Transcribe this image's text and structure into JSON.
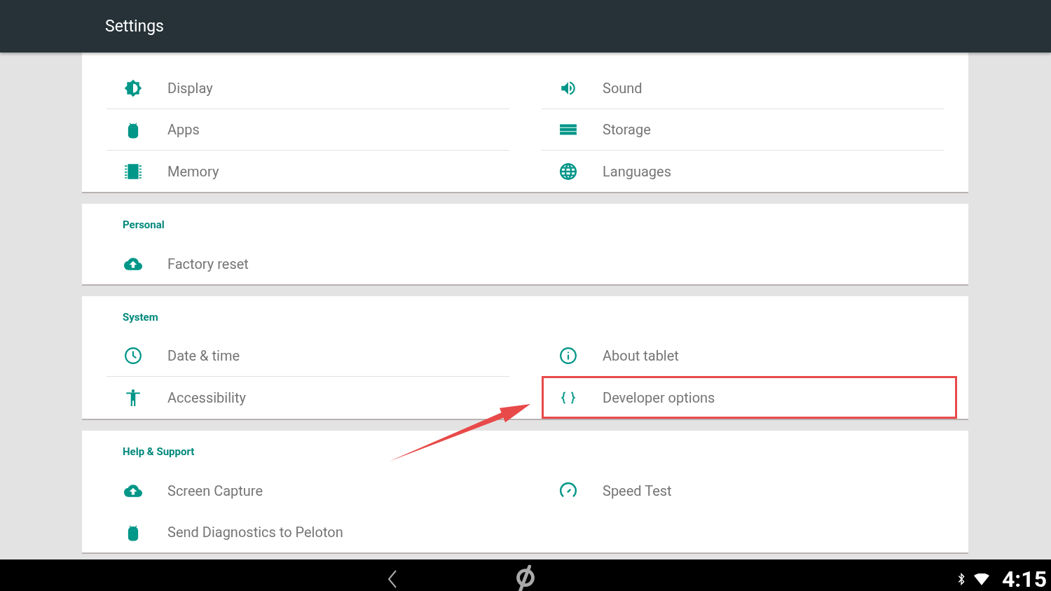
{
  "app_bar": {
    "title": "Settings"
  },
  "sections": [
    {
      "dividers": true,
      "items": [
        {
          "label": "Display",
          "kind": "brightness",
          "highlighted": false
        },
        {
          "label": "Sound",
          "kind": "volume",
          "highlighted": false
        },
        {
          "label": "Apps",
          "kind": "android",
          "highlighted": false
        },
        {
          "label": "Storage",
          "kind": "storage",
          "highlighted": false
        },
        {
          "label": "Memory",
          "kind": "chip",
          "highlighted": false
        },
        {
          "label": "Languages",
          "kind": "globe",
          "highlighted": false
        }
      ]
    },
    {
      "header": "Personal",
      "items": [
        {
          "label": "Factory reset",
          "kind": "cloud",
          "highlighted": false
        }
      ]
    },
    {
      "header": "System",
      "dividers": true,
      "items": [
        {
          "label": "Date & time",
          "kind": "clock",
          "highlighted": false
        },
        {
          "label": "About tablet",
          "kind": "info",
          "highlighted": false
        },
        {
          "label": "Accessibility",
          "kind": "accessibility",
          "highlighted": false
        },
        {
          "label": "Developer options",
          "kind": "braces",
          "highlighted": true
        }
      ]
    },
    {
      "header": "Help & Support",
      "dividers": false,
      "items": [
        {
          "label": "Screen Capture",
          "kind": "cloud",
          "highlighted": false
        },
        {
          "label": "Speed Test",
          "kind": "speed",
          "highlighted": false
        },
        {
          "label": "Send Diagnostics to Peloton",
          "kind": "android",
          "highlighted": false
        }
      ]
    }
  ],
  "nav_bar": {
    "time": "4:15"
  }
}
